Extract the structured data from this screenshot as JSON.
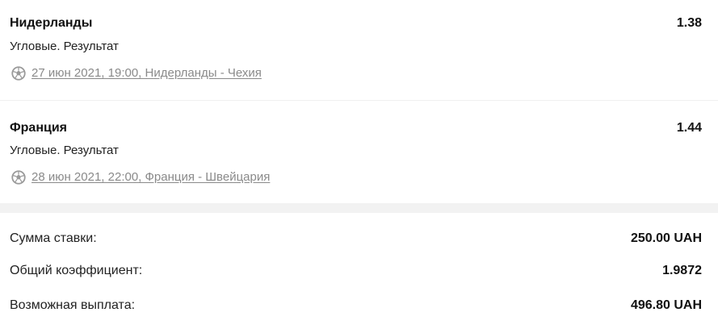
{
  "bets": [
    {
      "team": "Нидерланды",
      "odds": "1.38",
      "market": "Угловые. Результат",
      "event_icon": "soccer-ball-icon",
      "event": "27 июн 2021, 19:00, Нидерланды - Чехия"
    },
    {
      "team": "Франция",
      "odds": "1.44",
      "market": "Угловые. Результат",
      "event_icon": "soccer-ball-icon",
      "event": "28 июн 2021, 22:00, Франция - Швейцария"
    }
  ],
  "summary": {
    "stake_label": "Сумма ставки:",
    "stake_value": "250.00 UAH",
    "total_odds_label": "Общий коэффициент:",
    "total_odds_value": "1.9872",
    "payout_label": "Возможная выплата:",
    "payout_value": "496.80 UAH"
  },
  "colors": {
    "text": "#111111",
    "muted": "#8a8a8a",
    "separator": "#f2f2f2"
  }
}
